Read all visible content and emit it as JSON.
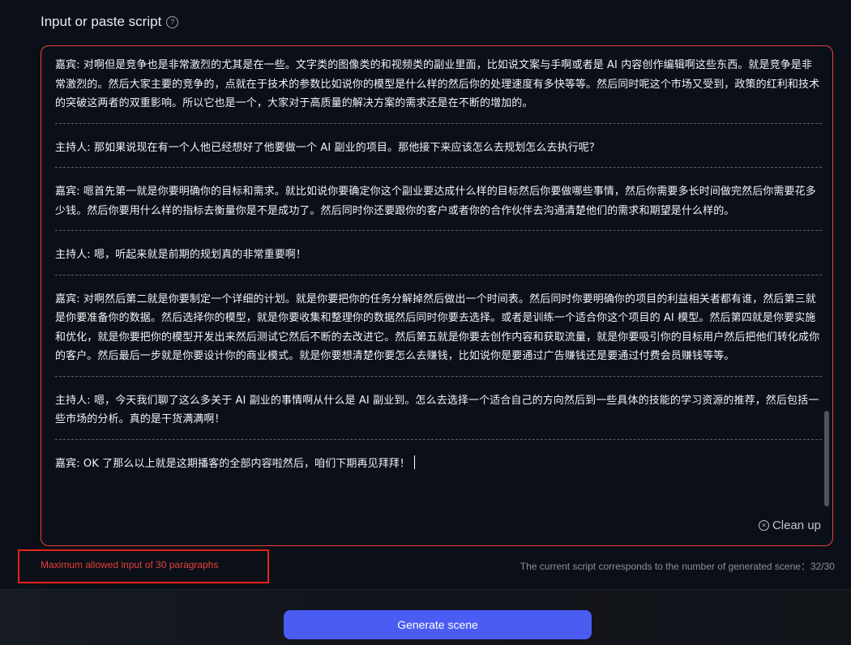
{
  "header": {
    "title": "Input or paste script",
    "help_icon": "?"
  },
  "script": {
    "paragraphs": [
      "嘉宾: 对啊但是竞争也是非常激烈的尤其是在一些。文字类的图像类的和视频类的副业里面，比如说文案与手啊或者是 AI 内容创作编辑啊这些东西。就是竞争是非常激烈的。然后大家主要的竞争的，点就在于技术的参数比如说你的模型是什么样的然后你的处理速度有多快等等。然后同时呢这个市场又受到，政策的红利和技术的突破这两者的双重影响。所以它也是一个，大家对于高质量的解决方案的需求还是在不断的增加的。",
      "主持人: 那如果说现在有一个人他已经想好了他要做一个 AI 副业的项目。那他接下来应该怎么去规划怎么去执行呢？",
      "嘉宾: 嗯首先第一就是你要明确你的目标和需求。就比如说你要确定你这个副业要达成什么样的目标然后你要做哪些事情，然后你需要多长时间做完然后你需要花多少钱。然后你要用什么样的指标去衡量你是不是成功了。然后同时你还要跟你的客户或者你的合作伙伴去沟通清楚他们的需求和期望是什么样的。",
      "主持人: 嗯，听起来就是前期的规划真的非常重要啊！",
      "嘉宾: 对啊然后第二就是你要制定一个详细的计划。就是你要把你的任务分解掉然后做出一个时间表。然后同时你要明确你的项目的利益相关者都有谁，然后第三就是你要准备你的数据。然后选择你的模型，就是你要收集和整理你的数据然后同时你要去选择。或者是训练一个适合你这个项目的 AI 模型。然后第四就是你要实施和优化，就是你要把你的模型开发出来然后测试它然后不断的去改进它。然后第五就是你要去创作内容和获取流量，就是你要吸引你的目标用户然后把他们转化成你的客户。然后最后一步就是你要设计你的商业模式。就是你要想清楚你要怎么去赚钱，比如说你是要通过广告赚钱还是要通过付费会员赚钱等等。",
      "主持人: 嗯，今天我们聊了这么多关于 AI 副业的事情啊从什么是 AI 副业到。怎么去选择一个适合自己的方向然后到一些具体的技能的学习资源的推荐，然后包括一些市场的分析。真的是干货满满啊！",
      "嘉宾: OK 了那么以上就是这期播客的全部内容啦然后，咱们下期再见拜拜！"
    ]
  },
  "cleanup": {
    "label": "Clean up",
    "icon": "close-circle-icon"
  },
  "warning": {
    "text": "Maximum allowed input of 30 paragraphs"
  },
  "status": {
    "scene_count_text": "The current script corresponds to the number of generated scene：32/30"
  },
  "footer": {
    "generate_label": "Generate scene"
  },
  "colors": {
    "accent": "#4a5cf2",
    "error": "#e5231b",
    "background": "#0b0f17"
  }
}
